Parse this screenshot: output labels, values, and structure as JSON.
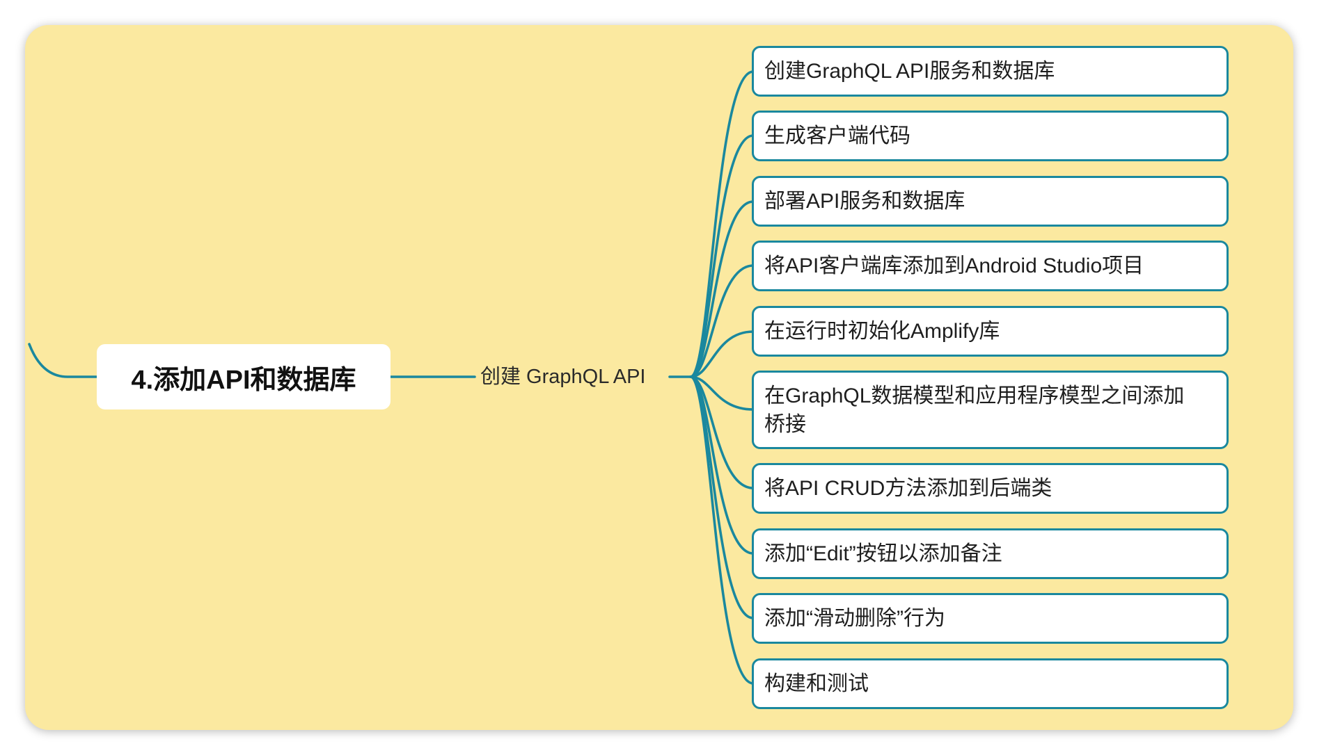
{
  "colors": {
    "canvas": "#fbe9a0",
    "connector": "#1a889e",
    "node_border": "#1a889e",
    "node_fill": "#ffffff",
    "text": "#1e1e1e"
  },
  "root_topic": {
    "label": "4.添加API和数据库"
  },
  "subtopic": {
    "label": "创建 GraphQL API"
  },
  "child_topics": [
    {
      "label": "创建GraphQL API服务和数据库"
    },
    {
      "label": "生成客户端代码"
    },
    {
      "label": "部署API服务和数据库"
    },
    {
      "label": "将API客户端库添加到Android Studio项目"
    },
    {
      "label": "在运行时初始化Amplify库"
    },
    {
      "label": "在GraphQL数据模型和应用程序模型之间添加桥接"
    },
    {
      "label": "将API CRUD方法添加到后端类"
    },
    {
      "label": "添加“Edit”按钮以添加备注"
    },
    {
      "label": "添加“滑动删除”行为"
    },
    {
      "label": "构建和测试"
    }
  ]
}
